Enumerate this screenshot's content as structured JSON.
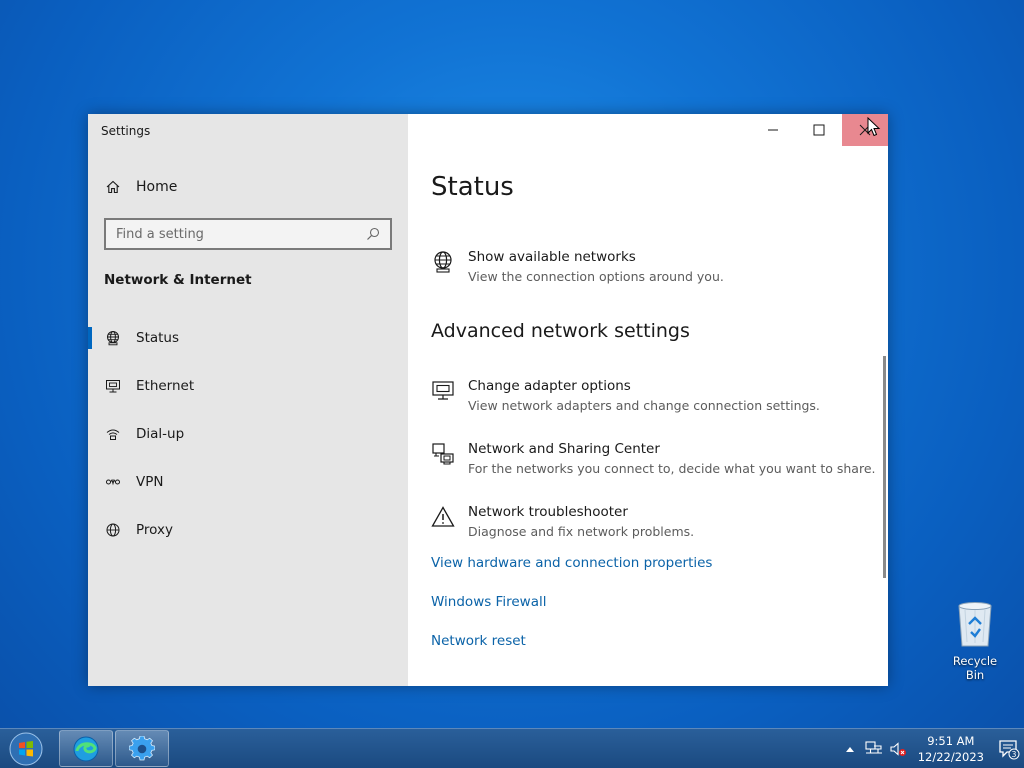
{
  "window": {
    "title": "Settings",
    "home_label": "Home",
    "search_placeholder": "Find a setting",
    "category": "Network & Internet",
    "nav": [
      {
        "label": "Status",
        "icon": "globe-icon",
        "active": true
      },
      {
        "label": "Ethernet",
        "icon": "ethernet-icon",
        "active": false
      },
      {
        "label": "Dial-up",
        "icon": "dialup-icon",
        "active": false
      },
      {
        "label": "VPN",
        "icon": "vpn-icon",
        "active": false
      },
      {
        "label": "Proxy",
        "icon": "globe-icon",
        "active": false
      }
    ]
  },
  "content": {
    "title": "Status",
    "show_networks": {
      "title": "Show available networks",
      "desc": "View the connection options around you."
    },
    "advanced_title": "Advanced network settings",
    "items": [
      {
        "title": "Change adapter options",
        "desc": "View network adapters and change connection settings.",
        "icon": "adapter-icon"
      },
      {
        "title": "Network and Sharing Center",
        "desc": "For the networks you connect to, decide what you want to share.",
        "icon": "sharing-center-icon"
      },
      {
        "title": "Network troubleshooter",
        "desc": "Diagnose and fix network problems.",
        "icon": "warning-icon"
      }
    ],
    "links": [
      "View hardware and connection properties",
      "Windows Firewall",
      "Network reset"
    ]
  },
  "desktop": {
    "recycle_bin": "Recycle Bin"
  },
  "taskbar": {
    "time": "9:51 AM",
    "date": "12/22/2023",
    "notification_count": "3"
  },
  "colors": {
    "accent": "#0067c0",
    "link": "#0b63a8",
    "close_hover": "#e88890",
    "sidebar_bg": "#e6e6e6"
  }
}
